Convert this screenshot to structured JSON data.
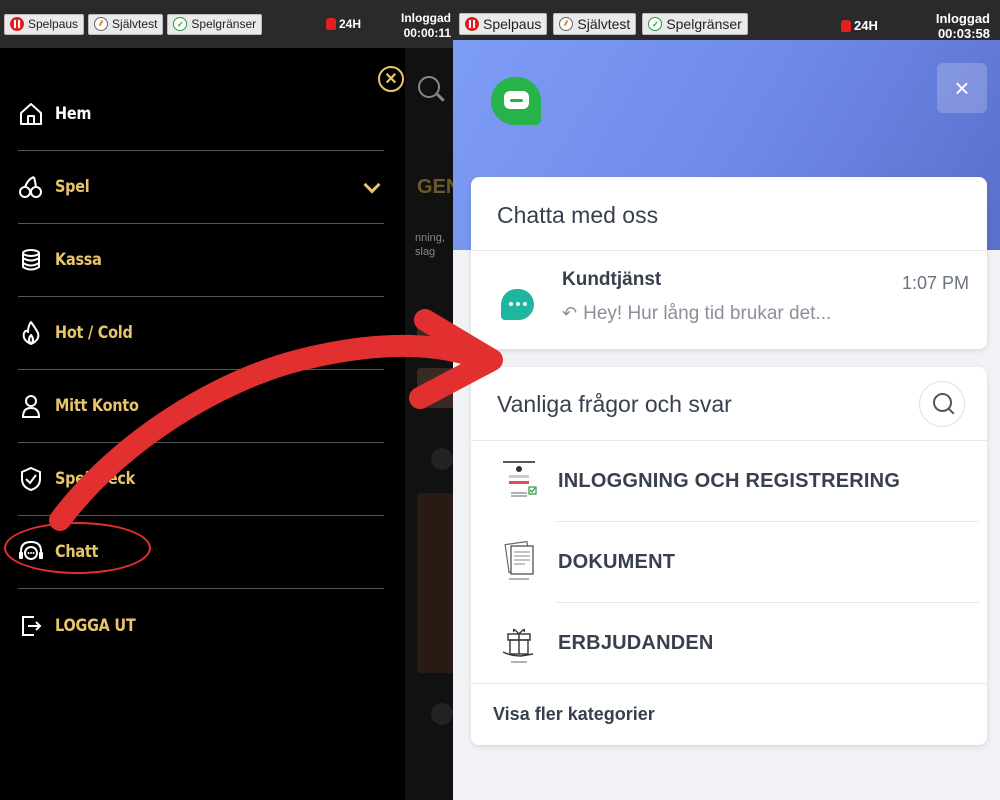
{
  "left": {
    "topbar": {
      "buttons": [
        {
          "label": "Spelpaus",
          "icon": "pause-icon"
        },
        {
          "label": "Självtest",
          "icon": "gauge-icon"
        },
        {
          "label": "Spelgränser",
          "icon": "limit-icon"
        }
      ],
      "hours": "24H",
      "login_label": "Inloggad",
      "login_time": "00:00:11"
    },
    "menu": [
      {
        "label": "Hem",
        "icon": "home-icon"
      },
      {
        "label": "Spel",
        "icon": "cherries-icon",
        "expandable": true
      },
      {
        "label": "Kassa",
        "icon": "coins-icon"
      },
      {
        "label": "Hot / Cold",
        "icon": "flame-icon"
      },
      {
        "label": "Mitt Konto",
        "icon": "user-icon"
      },
      {
        "label": "Spelcheck",
        "icon": "shield-check-icon"
      },
      {
        "label": "Chatt",
        "icon": "headset-chat-icon"
      },
      {
        "label": "LOGGA UT",
        "icon": "logout-icon"
      }
    ],
    "peek": {
      "heading": "GEN",
      "line1": "nning,",
      "line2": "slag"
    }
  },
  "right": {
    "topbar": {
      "buttons": [
        {
          "label": "Spelpaus",
          "icon": "pause-icon"
        },
        {
          "label": "Självtest",
          "icon": "gauge-icon"
        },
        {
          "label": "Spelgränser",
          "icon": "limit-icon"
        }
      ],
      "hours": "24H",
      "login_label": "Inloggad",
      "login_time": "00:03:58"
    },
    "chat_card": {
      "title": "Chatta med oss",
      "conversation": {
        "name": "Kundtjänst",
        "time": "1:07 PM",
        "message": "Hey! Hur lång tid brukar det..."
      }
    },
    "faq_card": {
      "title": "Vanliga frågor och svar",
      "items": [
        {
          "label": "INLOGGNING OCH REGISTRERING",
          "thumb": "login-registration-icon"
        },
        {
          "label": "DOKUMENT",
          "thumb": "document-icon"
        },
        {
          "label": "ERBJUDANDEN",
          "thumb": "gift-icon"
        }
      ],
      "more": "Visa fler kategorier"
    },
    "close": "×"
  },
  "colors": {
    "menu_gold": "#e8c46a",
    "annotation_red": "#e23030",
    "hero_blue": "#7e9df5",
    "chat_green": "#27b24a",
    "teal": "#1fb6a0"
  }
}
